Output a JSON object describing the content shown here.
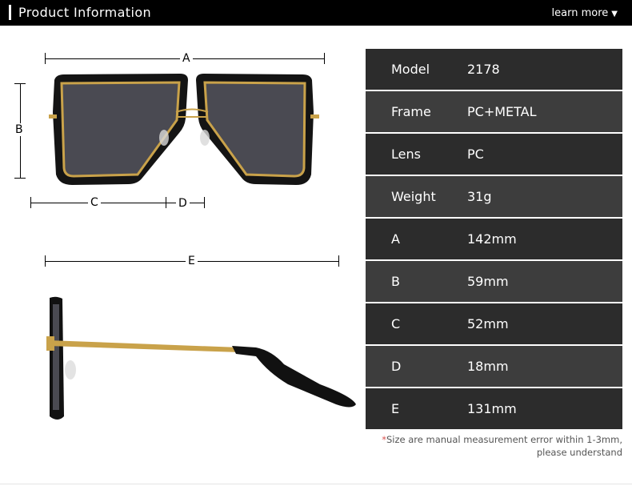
{
  "header": {
    "title": "Product Information",
    "learn_more": "learn more",
    "learn_more_arrow": "▼"
  },
  "dimensions": {
    "A": "A",
    "B": "B",
    "C": "C",
    "D": "D",
    "E": "E"
  },
  "specs": [
    {
      "label": "Model",
      "value": "2178"
    },
    {
      "label": "Frame",
      "value": "PC+METAL"
    },
    {
      "label": "Lens",
      "value": "PC"
    },
    {
      "label": "Weight",
      "value": "31g"
    },
    {
      "label": "A",
      "value": "142mm"
    },
    {
      "label": "B",
      "value": "59mm"
    },
    {
      "label": "C",
      "value": "52mm"
    },
    {
      "label": "D",
      "value": "18mm"
    },
    {
      "label": "E",
      "value": "131mm"
    }
  ],
  "note": {
    "star": "*",
    "line1": "Size are manual measurement error within 1-3mm,",
    "line2": "please understand"
  },
  "colors": {
    "header_bg": "#000000",
    "row_dark": "#2c2c2c",
    "row_light": "#3d3d3d",
    "frame_gold": "#c9a24a",
    "lens": "#4a4a52"
  }
}
